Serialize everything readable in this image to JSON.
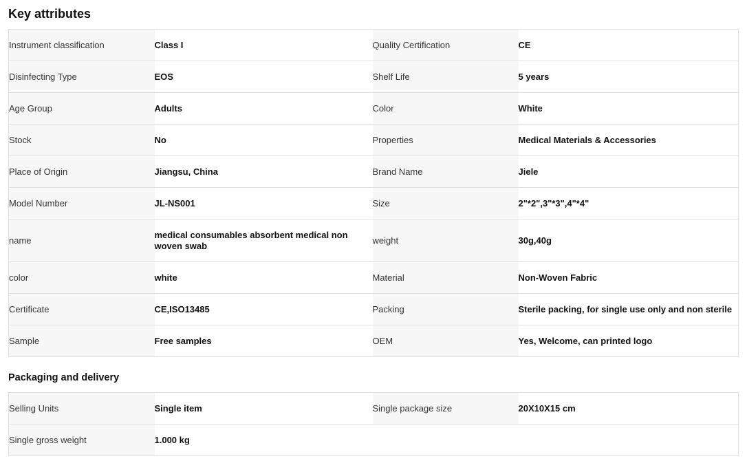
{
  "key_attributes": {
    "title": "Key attributes",
    "rows": [
      {
        "k1": "Instrument classification",
        "v1": "Class I",
        "k2": "Quality Certification",
        "v2": "CE"
      },
      {
        "k1": "Disinfecting Type",
        "v1": "EOS",
        "k2": "Shelf Life",
        "v2": "5 years"
      },
      {
        "k1": "Age Group",
        "v1": "Adults",
        "k2": "Color",
        "v2": "White"
      },
      {
        "k1": "Stock",
        "v1": "No",
        "k2": "Properties",
        "v2": "Medical Materials & Accessories"
      },
      {
        "k1": "Place of Origin",
        "v1": "Jiangsu, China",
        "k2": "Brand Name",
        "v2": "Jiele"
      },
      {
        "k1": "Model Number",
        "v1": "JL-NS001",
        "k2": "Size",
        "v2": "2\"*2\",3\"*3\",4\"*4\""
      },
      {
        "k1": "name",
        "v1": "medical consumables absorbent medical non woven swab",
        "k2": "weight",
        "v2": "30g,40g"
      },
      {
        "k1": "color",
        "v1": "white",
        "k2": "Material",
        "v2": "Non-Woven Fabric"
      },
      {
        "k1": "Certificate",
        "v1": "CE,ISO13485",
        "k2": "Packing",
        "v2": "Sterile packing, for single use only and non sterile"
      },
      {
        "k1": "Sample",
        "v1": "Free samples",
        "k2": "OEM",
        "v2": "Yes, Welcome, can printed logo"
      }
    ]
  },
  "packaging": {
    "title": "Packaging and delivery",
    "rows": [
      {
        "k1": "Selling Units",
        "v1": "Single item",
        "k2": "Single package size",
        "v2": "20X10X15 cm"
      },
      {
        "k1": "Single gross weight",
        "v1": "1.000 kg",
        "k2": "",
        "v2": ""
      }
    ]
  }
}
